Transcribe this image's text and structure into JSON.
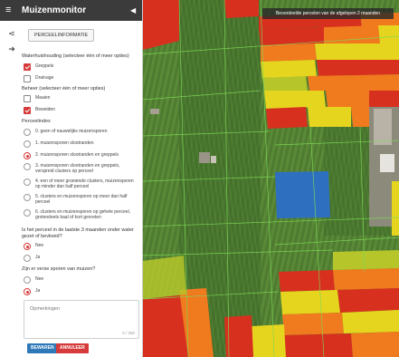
{
  "app": {
    "title": "Muizenmonitor",
    "menu_icon": "hamburger-icon",
    "collapse_icon": "caret-left-icon"
  },
  "tabs": {
    "perceelinformatie": "PERCEELINFORMATIE"
  },
  "form": {
    "waterhuishouding": {
      "label": "Waterhuishouding (selecteer één of meer opties)",
      "options": [
        {
          "label": "Greppels",
          "checked": true
        },
        {
          "label": "Drainage",
          "checked": false
        }
      ]
    },
    "beheer": {
      "label": "Beheer (selecteer één of meer opties)",
      "options": [
        {
          "label": "Maaien",
          "checked": false
        },
        {
          "label": "Beweiden",
          "checked": true
        }
      ]
    },
    "perceelindex": {
      "label": "Perceelindex",
      "options": [
        {
          "label": "0. geen of nauwelijks muizensporen",
          "selected": false
        },
        {
          "label": "1. muizensporen slootranden",
          "selected": false
        },
        {
          "label": "2. muizensporen slootranden en greppels",
          "selected": true
        },
        {
          "label": "3. muizensporen slootranden en greppels, verspreid clusters op perceel",
          "selected": false
        },
        {
          "label": "4. een of meer groeiende clusters, muizensporen op minder dan half perceel",
          "selected": false
        },
        {
          "label": "5. clusters en muizensporen op meer dan half perceel",
          "selected": false
        },
        {
          "label": "6. clusters en muizensporen op gehele perceel, grotendeels kaal of kort gevreten",
          "selected": false
        }
      ]
    },
    "onder_water": {
      "label": "Is het perceel in de laatste 3 maanden onder water gezet of bevloeid?",
      "options": [
        {
          "label": "Nee",
          "selected": true
        },
        {
          "label": "Ja",
          "selected": false
        }
      ]
    },
    "verse_sporen": {
      "label": "Zijn er verse sporen van muizen?",
      "options": [
        {
          "label": "Nee",
          "selected": false
        },
        {
          "label": "Ja",
          "selected": true
        }
      ]
    },
    "opmerkingen": {
      "placeholder": "Opmerkingen",
      "counter": "0 / 250"
    },
    "buttons": {
      "save": "BEWAREN",
      "cancel": "ANNULEER"
    }
  },
  "map": {
    "banner": "Beoordeelde percelen van de afgelopen 2 maanden",
    "colors": {
      "red": "#d7301f",
      "orange": "#f07a1e",
      "yellow": "#e6d51e",
      "yellowgreen": "#b5c52a",
      "blue": "#2f6fc0",
      "field_dark": "#3f6b2a",
      "field_light": "#5d8a3a",
      "parcel_line": "#7ed957"
    }
  },
  "colors": {
    "accent_red": "#d63a3a",
    "save_blue": "#2f79b9",
    "titlebar": "#3b3b3b"
  }
}
